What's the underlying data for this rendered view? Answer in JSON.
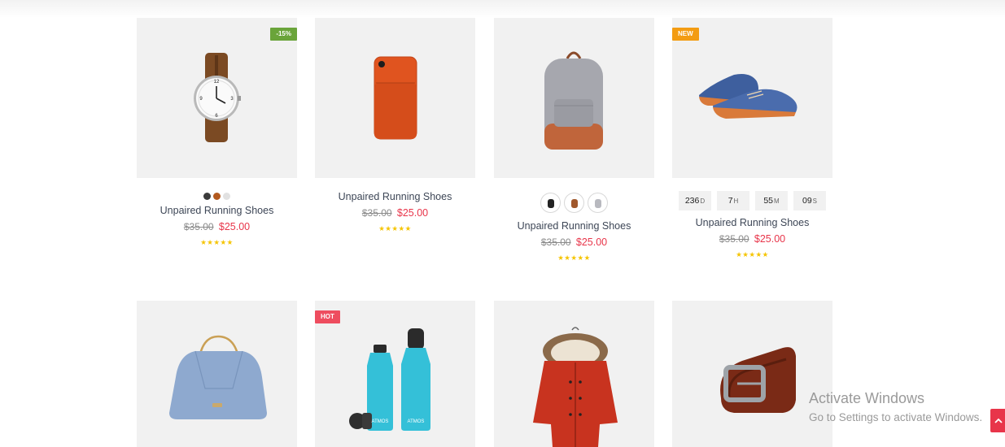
{
  "products": [
    {
      "title": "Unpaired Running Shoes",
      "old_price": "$35.00",
      "new_price": "$25.00",
      "badge": "-15%",
      "badge_color": "#6aa43a",
      "stars": "★★★★★",
      "image": "wristwatch"
    },
    {
      "title": "Unpaired Running Shoes",
      "old_price": "$35.00",
      "new_price": "$25.00",
      "badge": "",
      "stars": "★★★★★",
      "image": "phone-case"
    },
    {
      "title": "Unpaired Running Shoes",
      "old_price": "$35.00",
      "new_price": "$25.00",
      "badge": "",
      "stars": "★★★★★",
      "image": "backpack"
    },
    {
      "title": "Unpaired Running Shoes",
      "old_price": "$35.00",
      "new_price": "$25.00",
      "badge": "NEW",
      "badge_color": "#f39c12",
      "stars": "★★★★★",
      "image": "shoes",
      "countdown": [
        {
          "value": "236",
          "unit": "D"
        },
        {
          "value": "7",
          "unit": "H"
        },
        {
          "value": "55",
          "unit": "M"
        },
        {
          "value": "09",
          "unit": "S"
        }
      ]
    },
    {
      "badge": "",
      "image": "handbag"
    },
    {
      "badge": "HOT",
      "badge_color": "#ee4d5f",
      "image": "water-bottles"
    },
    {
      "badge": "",
      "image": "winter-jacket"
    },
    {
      "badge": "",
      "image": "leather-belt"
    }
  ],
  "swatch_colors": [
    "#3b3b3b",
    "#b35a1f",
    "#e1e1e1"
  ],
  "overlay": {
    "activate_title": "Activate Windows",
    "activate_sub": "Go to Settings to activate Windows."
  },
  "colors": {
    "price": "#e8354a",
    "stars": "#f5c400",
    "card_bg": "#f1f1f1"
  }
}
